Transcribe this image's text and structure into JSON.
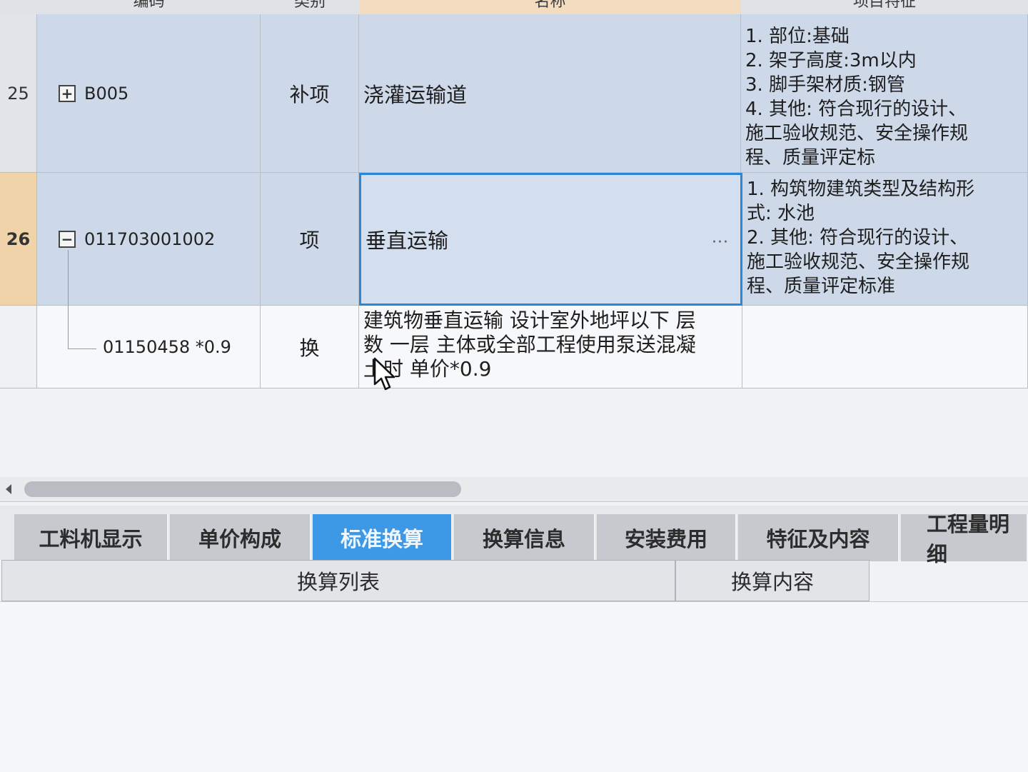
{
  "grid": {
    "header": {
      "code": "编码",
      "type": "类别",
      "name": "名称",
      "features": "项目特征"
    },
    "rows": [
      {
        "num": "25",
        "code": "B005",
        "type": "补项",
        "name": "浇灌运输道",
        "features": [
          "1. 部位:基础",
          "2. 架子高度:3m以内",
          "3. 脚手架材质:钢管",
          "4. 其他: 符合现行的设计、",
          "施工验收规范、安全操作规",
          "程、质量评定标"
        ]
      },
      {
        "num": "26",
        "code": "011703001002",
        "type": "项",
        "name": "垂直运输",
        "name_action": "···",
        "features": [
          "1. 构筑物建筑类型及结构形",
          "式: 水池",
          "2. 其他: 符合现行的设计、",
          "施工验收规范、安全操作规",
          "程、质量评定标准"
        ]
      },
      {
        "num": "",
        "code": "01150458 *0.9",
        "type": "换",
        "name_lines": [
          "建筑物垂直运输 设计室外地坪以下 层",
          "数 一层  主体或全部工程使用泵送混凝",
          "土时 单价*0.9"
        ]
      }
    ]
  },
  "tabs": [
    {
      "label": "工料机显示"
    },
    {
      "label": "单价构成"
    },
    {
      "label": "标准换算"
    },
    {
      "label": "换算信息"
    },
    {
      "label": "安装费用"
    },
    {
      "label": "特征及内容"
    },
    {
      "label": "工程量明细"
    }
  ],
  "subpanel": {
    "list_header": "换算列表",
    "content_header": "换算内容"
  },
  "colors": {
    "active_tab": "#3d98e6",
    "selected_border": "#2a86d8",
    "row_selected": "#cdd8e8"
  }
}
